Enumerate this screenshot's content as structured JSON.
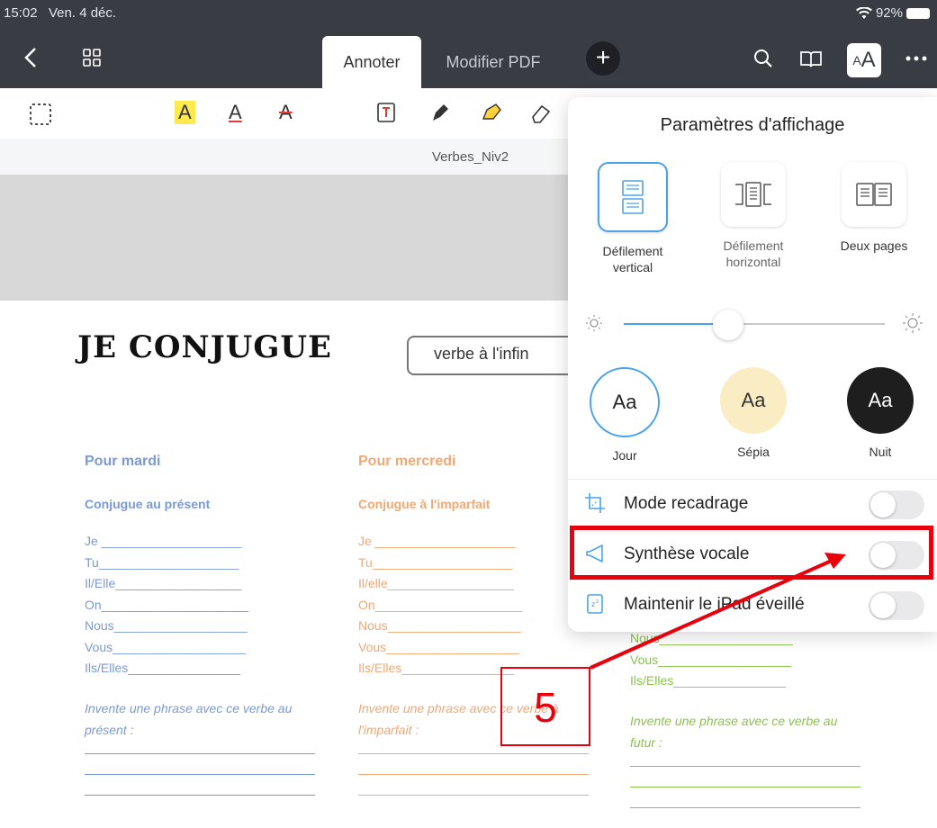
{
  "status": {
    "time": "15:02",
    "date": "Ven. 4 déc.",
    "battery": "92%"
  },
  "nav": {
    "tabs": [
      "Annoter",
      "Modifier PDF"
    ],
    "plus": "+",
    "aa": "AA"
  },
  "toolbar": {
    "text_tools": [
      "A",
      "A",
      "A"
    ]
  },
  "document": {
    "title": "Verbes_Niv2",
    "heading": "JE CONJUGUE",
    "verbe_box": "verbe à l'infin",
    "columns": [
      {
        "head": "Pour mardi",
        "sub": "Conjugue au présent",
        "rows": [
          "Je ____________________",
          "Tu____________________",
          "Il/Elle__________________",
          "On_____________________",
          "Nous___________________",
          "Vous___________________",
          "Ils/Elles________________"
        ],
        "invent": "Invente une phrase avec ce verbe au présent :"
      },
      {
        "head": "Pour mercredi",
        "sub": "Conjugue à l'imparfait",
        "rows": [
          "Je ____________________",
          "Tu____________________",
          "Il/elle__________________",
          "On_____________________",
          "Nous___________________",
          "Vous___________________",
          "Ils/Elles________________"
        ],
        "invent": "Invente une phrase avec ce verbe à l'imparfait :"
      },
      {
        "rows": [
          "Nous___________________",
          "Vous___________________",
          "Ils/Elles________________"
        ],
        "invent": "Invente une phrase avec ce verbe au futur :"
      }
    ]
  },
  "popover": {
    "title": "Paramètres d'affichage",
    "modes": [
      {
        "label1": "Défilement",
        "label2": "vertical"
      },
      {
        "label1": "Défilement",
        "label2": "horizontal"
      },
      {
        "label1": "Deux pages",
        "label2": ""
      }
    ],
    "brightness": 0.4,
    "themes": [
      {
        "text": "Aa",
        "label": "Jour"
      },
      {
        "text": "Aa",
        "label": "Sépia"
      },
      {
        "text": "Aa",
        "label": "Nuit"
      }
    ],
    "settings": [
      {
        "label": "Mode recadrage"
      },
      {
        "label": "Synthèse vocale"
      },
      {
        "label": "Maintenir le iPad éveillé"
      }
    ]
  },
  "annotation": {
    "step": "5"
  }
}
